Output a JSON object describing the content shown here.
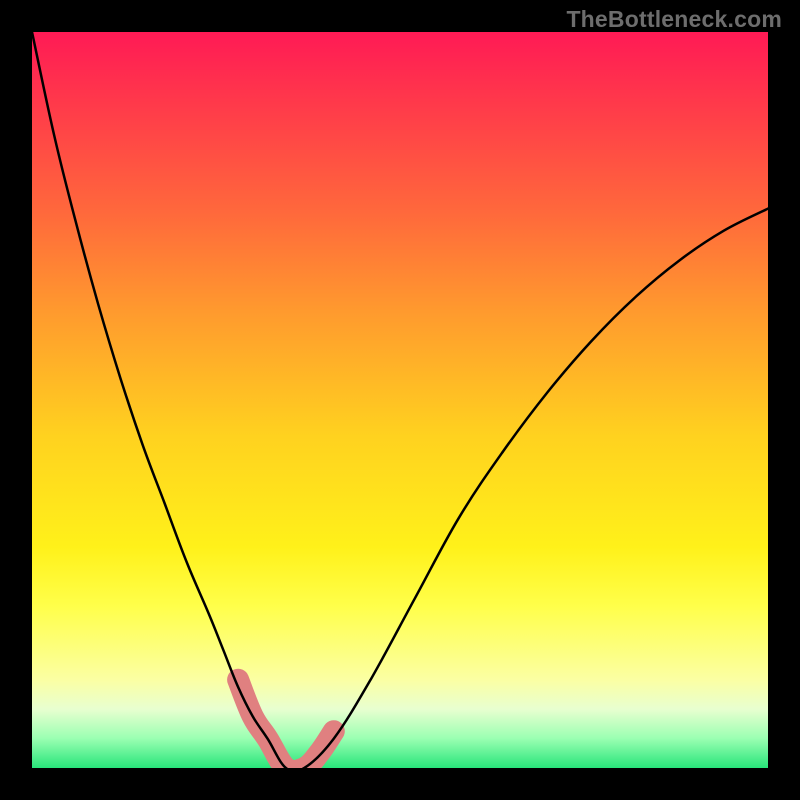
{
  "watermark": "TheBottleneck.com",
  "chart_data": {
    "type": "line",
    "title": "",
    "xlabel": "",
    "ylabel": "",
    "xlim": [
      0,
      100
    ],
    "ylim": [
      0,
      100
    ],
    "grid": false,
    "legend": false,
    "background_gradient": {
      "stops": [
        {
          "pct": 0,
          "color": "#ff1a55"
        },
        {
          "pct": 10,
          "color": "#ff3a4a"
        },
        {
          "pct": 25,
          "color": "#ff6a3b"
        },
        {
          "pct": 38,
          "color": "#ff9a2e"
        },
        {
          "pct": 55,
          "color": "#ffd21f"
        },
        {
          "pct": 70,
          "color": "#fff11a"
        },
        {
          "pct": 78,
          "color": "#ffff4a"
        },
        {
          "pct": 88,
          "color": "#fbffa3"
        },
        {
          "pct": 92,
          "color": "#e8ffd0"
        },
        {
          "pct": 96,
          "color": "#9affb2"
        },
        {
          "pct": 100,
          "color": "#28e57a"
        }
      ]
    },
    "series": [
      {
        "name": "main-curve",
        "color": "#000000",
        "stroke_width": 2,
        "x": [
          0,
          3,
          6,
          9,
          12,
          15,
          18,
          21,
          24,
          26,
          28,
          30,
          32,
          34.5,
          37,
          41,
          46,
          52,
          58,
          64,
          70,
          76,
          82,
          88,
          94,
          100
        ],
        "y": [
          100,
          86,
          74,
          63,
          53,
          44,
          36,
          28,
          21,
          16,
          11,
          7,
          4,
          0,
          0,
          4,
          12,
          23,
          34,
          43,
          51,
          58,
          64,
          69,
          73,
          76
        ]
      },
      {
        "name": "highlight-curve",
        "color": "#e08080",
        "stroke_width": 12,
        "x": [
          28,
          30,
          32,
          34.5,
          37,
          39,
          41
        ],
        "y": [
          12,
          7,
          4,
          0,
          0,
          2,
          5
        ]
      }
    ]
  }
}
